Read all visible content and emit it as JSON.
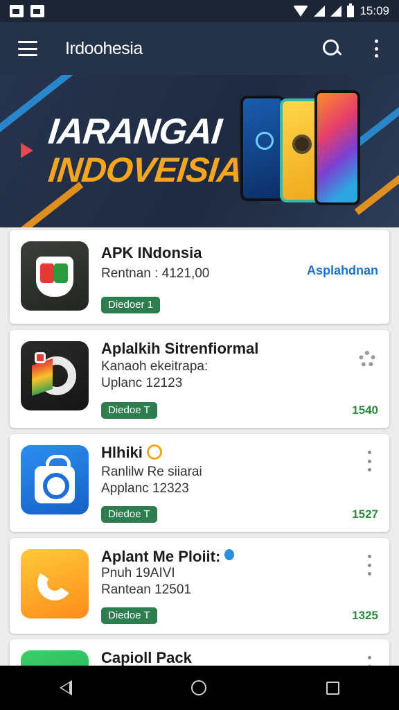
{
  "status_bar": {
    "time": "15:09"
  },
  "app_bar": {
    "title": "Irdoohesia"
  },
  "banner": {
    "line1": "IARANGAI",
    "line2": "INDOVEISIA"
  },
  "apps": [
    {
      "title": "APK INdonsia",
      "line1": "Rentnan : 4121,00",
      "line2": "",
      "badge": "Diedoer 1",
      "action": "Asplahdnan",
      "number": ""
    },
    {
      "title": "Aplalkih Sitrenfiormal",
      "line1": "Kanaoh ekeitrapa:",
      "line2": "Uplanc 12123",
      "badge": "Diedoe T",
      "action": "",
      "number": "1540"
    },
    {
      "title": "Hlhiki",
      "line1": "Ranlilw Re siiarai",
      "line2": "Applanc 12323",
      "badge": "Diedoe T",
      "action": "",
      "number": "1527"
    },
    {
      "title": "Aplant Me Ploiit:",
      "line1": "Pnuh 19AIVI",
      "line2": "Rantean 12501",
      "badge": "Diedoe T",
      "action": "",
      "number": "1325"
    },
    {
      "title": "Capioll Pack",
      "line1": "",
      "line2": "",
      "badge": "",
      "action": "",
      "number": ""
    }
  ]
}
